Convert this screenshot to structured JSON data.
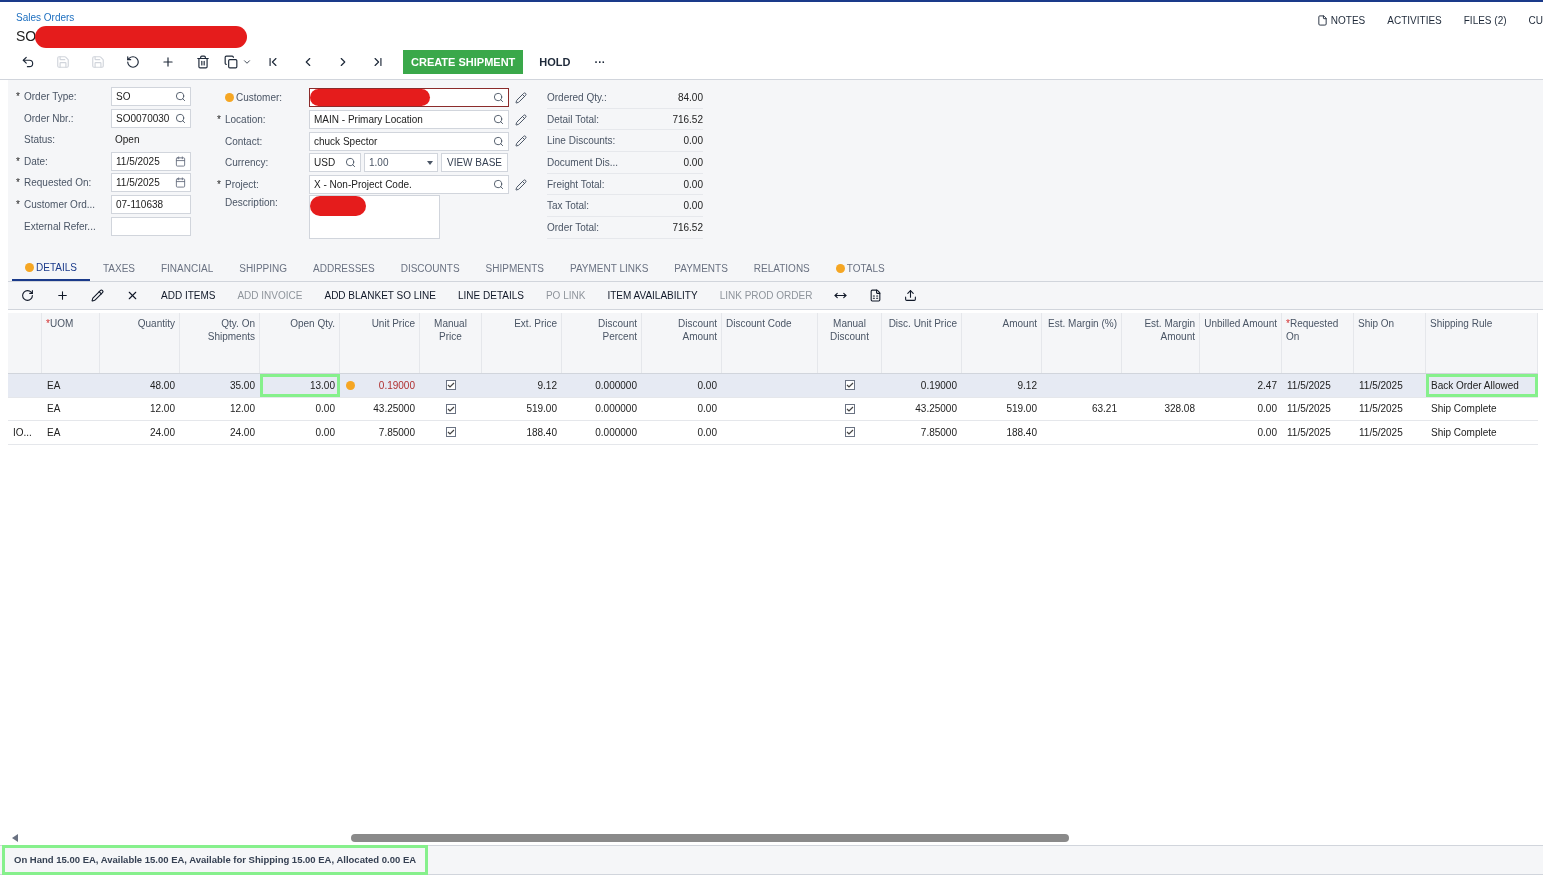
{
  "breadcrumb": "Sales Orders",
  "title": {
    "text": "SO",
    "redacted": true
  },
  "header_links": [
    {
      "label": "NOTES",
      "kind": "notes"
    },
    {
      "label": "ACTIVITIES",
      "kind": "plain"
    },
    {
      "label": "FILES (2)",
      "kind": "plain"
    },
    {
      "label": "CU",
      "kind": "plain"
    }
  ],
  "toolbar": {
    "icons": [
      {
        "kind": "back",
        "disabled": false
      },
      {
        "kind": "save-close",
        "disabled": true
      },
      {
        "kind": "save",
        "disabled": true
      },
      {
        "kind": "undo",
        "disabled": false
      },
      {
        "kind": "add",
        "disabled": false
      },
      {
        "kind": "delete",
        "disabled": false
      },
      {
        "kind": "copy",
        "disabled": false
      },
      {
        "kind": "first",
        "disabled": false
      },
      {
        "kind": "prev",
        "disabled": false
      },
      {
        "kind": "next",
        "disabled": false
      },
      {
        "kind": "last",
        "disabled": false
      }
    ],
    "buttons": [
      {
        "label": "CREATE SHIPMENT",
        "primary": true
      },
      {
        "label": "HOLD",
        "primary": false
      },
      {
        "label": "···",
        "primary": false
      }
    ]
  },
  "form": {
    "left": [
      {
        "mark": "*",
        "label": "Order Type:",
        "kind": "lookup",
        "value": "SO"
      },
      {
        "label": "Order Nbr.:",
        "kind": "lookup",
        "value": "SO0070030"
      },
      {
        "label": "Status:",
        "kind": "plain",
        "value": "Open"
      },
      {
        "mark": "*",
        "label": "Date:",
        "kind": "date",
        "value": "11/5/2025"
      },
      {
        "mark": "*",
        "label": "Requested On:",
        "kind": "date",
        "value": "11/5/2025"
      },
      {
        "mark": "*",
        "label": "Customer Ord...",
        "kind": "text",
        "value": "07-110638"
      },
      {
        "label": "External Refer...",
        "kind": "text"
      }
    ],
    "middle": [
      {
        "label": "Customer:",
        "warning": true,
        "kind": "lookup",
        "redacted": true
      },
      {
        "mark": "*",
        "label": "Location:",
        "warning": false,
        "kind": "lookup",
        "value": "MAIN - Primary Location",
        "redacted": false
      },
      {
        "label": "Contact:",
        "warning": false,
        "kind": "lookup",
        "value": "chuck Spector",
        "redacted": false
      },
      {
        "label": "Currency:",
        "warning": false,
        "kind": "currency",
        "value": "USD",
        "rate": "1.00",
        "button": "VIEW BASE"
      },
      {
        "mark": "*",
        "label": "Project:",
        "warning": false,
        "kind": "lookup",
        "value": "X - Non-Project Code.",
        "redacted": false
      },
      {
        "label": "Description:",
        "warning": false,
        "kind": "textarea",
        "redacted": true
      }
    ],
    "totals": [
      {
        "label": "Ordered Qty.:",
        "value": "84.00"
      },
      {
        "label": "Detail Total:",
        "value": "716.52"
      },
      {
        "label": "Line Discounts:",
        "value": "0.00"
      },
      {
        "label": "Document Dis...",
        "value": "0.00"
      },
      {
        "label": "Freight Total:",
        "value": "0.00"
      },
      {
        "label": "Tax Total:",
        "value": "0.00"
      },
      {
        "label": "Order Total:",
        "value": "716.52"
      }
    ]
  },
  "tabs": [
    {
      "label": "DETAILS",
      "selected": true,
      "warning": true
    },
    {
      "label": "TAXES",
      "selected": false,
      "warning": false
    },
    {
      "label": "FINANCIAL",
      "selected": false,
      "warning": false
    },
    {
      "label": "SHIPPING",
      "selected": false,
      "warning": false
    },
    {
      "label": "ADDRESSES",
      "selected": false,
      "warning": false
    },
    {
      "label": "DISCOUNTS",
      "selected": false,
      "warning": false
    },
    {
      "label": "SHIPMENTS",
      "selected": false,
      "warning": false
    },
    {
      "label": "PAYMENT LINKS",
      "selected": false,
      "warning": false
    },
    {
      "label": "PAYMENTS",
      "selected": false,
      "warning": false
    },
    {
      "label": "RELATIONS",
      "selected": false,
      "warning": false
    },
    {
      "label": "TOTALS",
      "selected": false,
      "warning": true
    }
  ],
  "grid_toolbar": [
    {
      "kind": "refresh",
      "disabled": false
    },
    {
      "kind": "add",
      "disabled": false
    },
    {
      "kind": "edit",
      "disabled": false
    },
    {
      "kind": "delete",
      "disabled": false
    },
    {
      "kind": "text",
      "label": "ADD ITEMS",
      "disabled": false
    },
    {
      "kind": "text",
      "label": "ADD INVOICE",
      "disabled": true
    },
    {
      "kind": "text",
      "label": "ADD BLANKET SO LINE",
      "disabled": false
    },
    {
      "kind": "text",
      "label": "LINE DETAILS",
      "disabled": false
    },
    {
      "kind": "text",
      "label": "PO LINK",
      "disabled": true
    },
    {
      "kind": "text",
      "label": "ITEM AVAILABILITY",
      "disabled": false
    },
    {
      "kind": "text",
      "label": "LINK PROD ORDER",
      "disabled": true
    },
    {
      "kind": "fit",
      "disabled": false
    },
    {
      "kind": "excel",
      "disabled": false
    },
    {
      "kind": "upload",
      "disabled": false
    }
  ],
  "table": {
    "columns": [
      {
        "kind": "text"
      },
      {
        "mark": "*",
        "label": "UOM",
        "kind": "text"
      },
      {
        "label": "Quantity",
        "kind": "text"
      },
      {
        "label": "Qty. On Shipments",
        "kind": "text"
      },
      {
        "label": "Open Qty.",
        "kind": "text"
      },
      {
        "label": "Unit Price",
        "kind": "text"
      },
      {
        "label": "Manual Price",
        "kind": "check"
      },
      {
        "label": "Ext. Price",
        "kind": "text"
      },
      {
        "label": "Discount Percent",
        "kind": "text"
      },
      {
        "label": "Discount Amount",
        "kind": "text"
      },
      {
        "label": "Discount Code",
        "kind": "text"
      },
      {
        "label": "Manual Discount",
        "kind": "check"
      },
      {
        "label": "Disc. Unit Price",
        "kind": "text"
      },
      {
        "label": "Amount",
        "kind": "text"
      },
      {
        "label": "Est. Margin (%)",
        "kind": "text"
      },
      {
        "label": "Est. Margin Amount",
        "kind": "text"
      },
      {
        "label": "Unbilled Amount",
        "kind": "text"
      },
      {
        "mark": "*",
        "label": "Requested On",
        "kind": "text"
      },
      {
        "label": "Ship On",
        "kind": "text"
      },
      {
        "label": "Shipping Rule",
        "kind": "text"
      }
    ],
    "rows": [
      {
        "selected": true,
        "cells": [
          {},
          {
            "text": "EA"
          },
          {
            "text": "48.00"
          },
          {
            "text": "35.00"
          },
          {
            "text": "13.00",
            "highlighted": true
          },
          {
            "text": "0.19000",
            "warning": true
          },
          {
            "checked": true
          },
          {
            "text": "9.12"
          },
          {
            "text": "0.000000"
          },
          {
            "text": "0.00"
          },
          {},
          {
            "checked": true
          },
          {
            "text": "0.19000"
          },
          {
            "text": "9.12"
          },
          {},
          {},
          {
            "text": "2.47"
          },
          {
            "text": "11/5/2025"
          },
          {
            "text": "11/5/2025"
          },
          {
            "text": "Back Order Allowed",
            "highlighted": true
          }
        ]
      },
      {
        "selected": false,
        "cells": [
          {},
          {
            "text": "EA"
          },
          {
            "text": "12.00"
          },
          {
            "text": "12.00"
          },
          {
            "text": "0.00"
          },
          {
            "text": "43.25000"
          },
          {
            "checked": true
          },
          {
            "text": "519.00"
          },
          {
            "text": "0.000000"
          },
          {
            "text": "0.00"
          },
          {},
          {
            "checked": true
          },
          {
            "text": "43.25000"
          },
          {
            "text": "519.00"
          },
          {
            "text": "63.21"
          },
          {
            "text": "328.08"
          },
          {
            "text": "0.00"
          },
          {
            "text": "11/5/2025"
          },
          {
            "text": "11/5/2025"
          },
          {
            "text": "Ship Complete"
          }
        ]
      },
      {
        "selected": false,
        "cells": [
          {
            "text": "IO..."
          },
          {
            "text": "EA"
          },
          {
            "text": "24.00"
          },
          {
            "text": "24.00"
          },
          {
            "text": "0.00"
          },
          {
            "text": "7.85000"
          },
          {
            "checked": true
          },
          {
            "text": "188.40"
          },
          {
            "text": "0.000000"
          },
          {
            "text": "0.00"
          },
          {},
          {
            "checked": true
          },
          {
            "text": "7.85000"
          },
          {
            "text": "188.40"
          },
          {},
          {},
          {
            "text": "0.00"
          },
          {
            "text": "11/5/2025"
          },
          {
            "text": "11/5/2025"
          },
          {
            "text": "Ship Complete"
          }
        ]
      }
    ]
  },
  "status_bar": {
    "text": "On Hand 15.00 EA, Available 15.00 EA, Available for Shipping 15.00 EA, Allocated 0.00 EA",
    "highlighted": true
  }
}
